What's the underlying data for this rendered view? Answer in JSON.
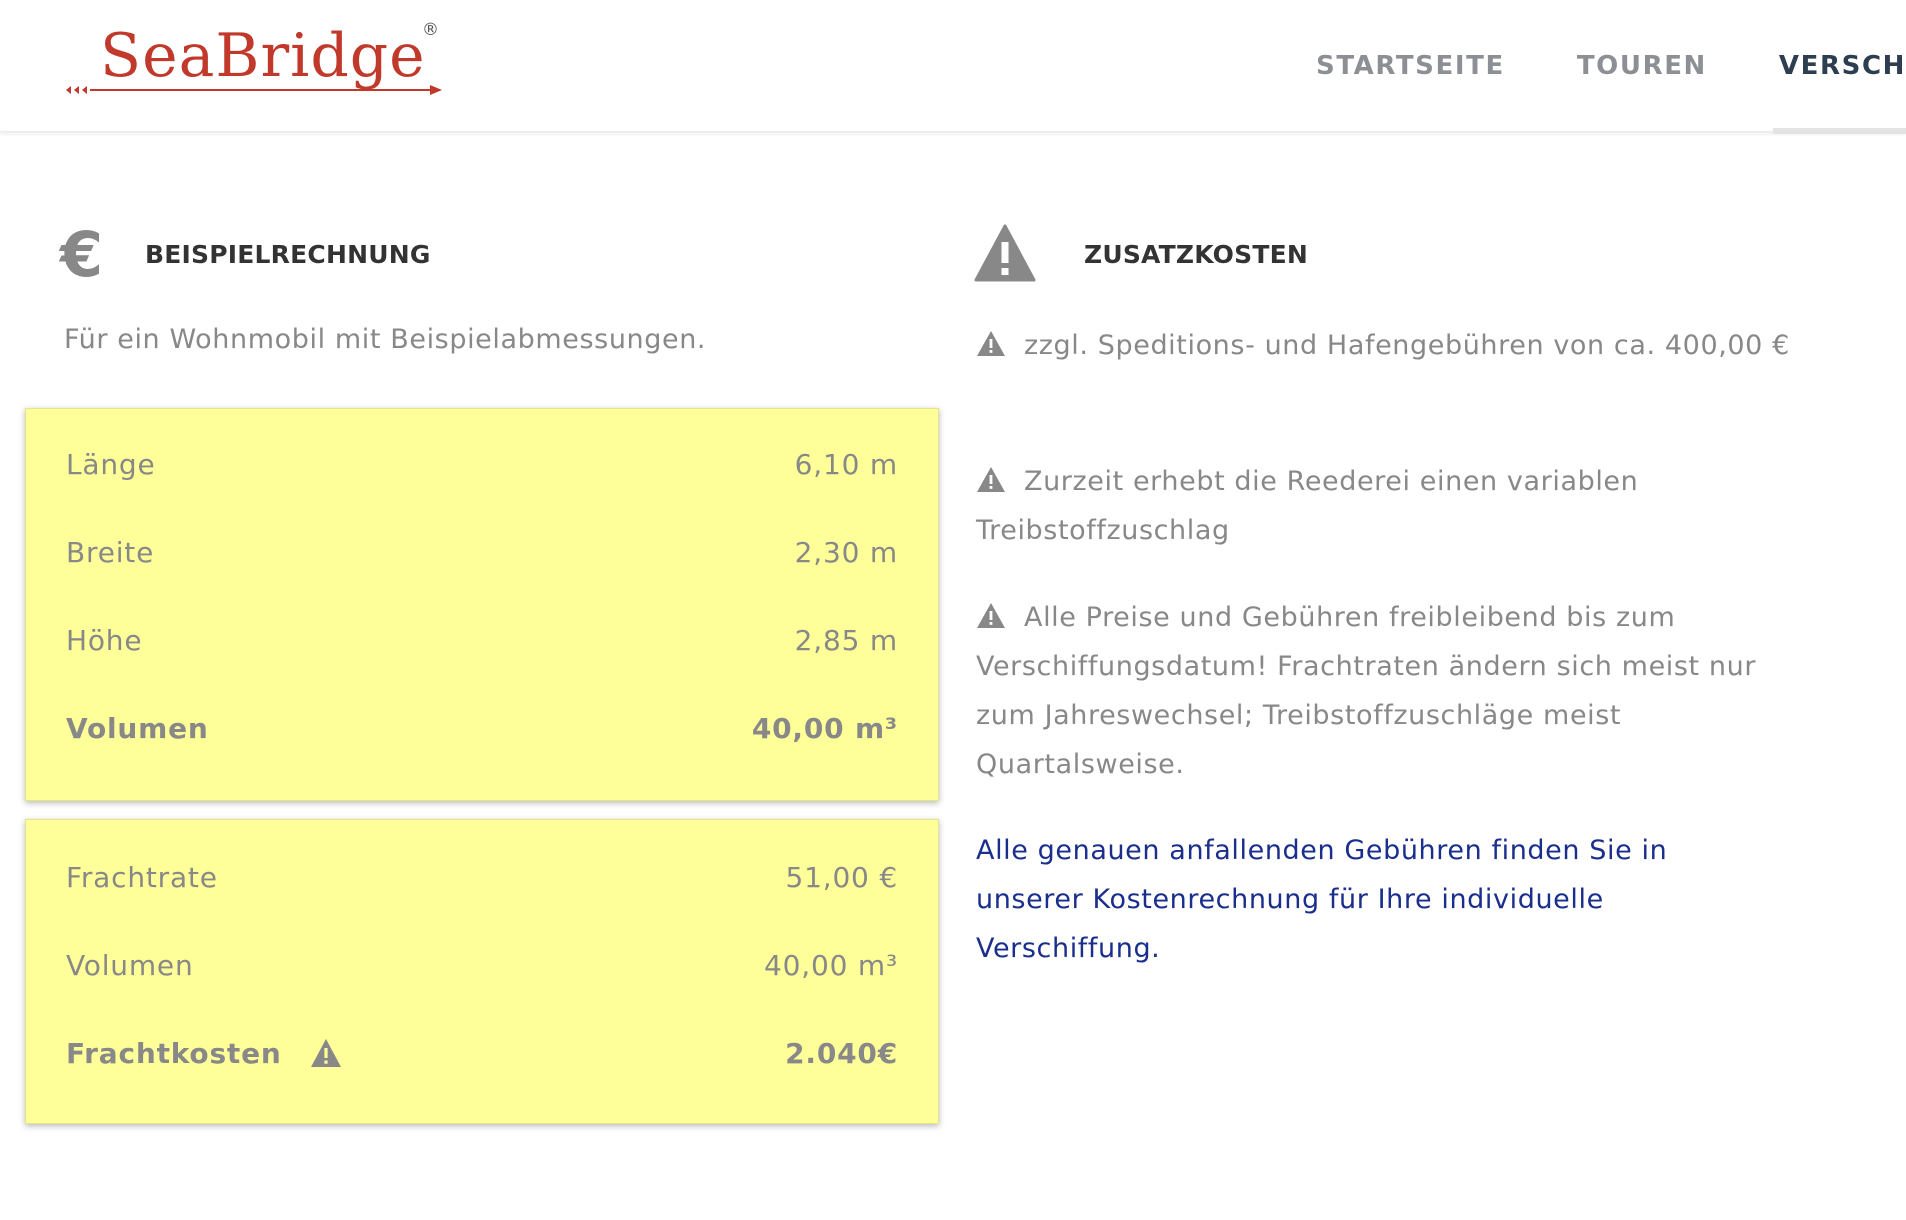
{
  "header": {
    "logo_text": "SeaBridge",
    "logo_reg": "®",
    "nav": [
      "STARTSEITE",
      "TOUREN",
      "VERSCH"
    ]
  },
  "beispiel": {
    "title": "BEISPIELRECHNUNG",
    "euro_icon": "€",
    "intro": "Für ein Wohnmobil mit Beispielabmessungen.",
    "box1": [
      {
        "label": "Länge",
        "value": "6,10 m"
      },
      {
        "label": "Breite",
        "value": "2,30 m"
      },
      {
        "label": "Höhe",
        "value": "2,85 m"
      },
      {
        "label": "Volumen",
        "value": "40,00 m³"
      }
    ],
    "box2": [
      {
        "label": "Frachtrate",
        "value": "51,00 €"
      },
      {
        "label": "Volumen",
        "value": "40,00 m³"
      },
      {
        "label": "Frachtkosten",
        "value": "2.040€"
      }
    ]
  },
  "zusatz": {
    "title": "ZUSATZKOSTEN",
    "items": [
      "zzgl. Speditions- und Hafengebühren von ca. 400,00 €",
      "Zurzeit erhebt die Reederei einen variablen Treibstoffzuschlag",
      "Alle Preise und Gebühren freibleibend bis zum Verschiffungsdatum! Frachtraten ändern sich meist nur zum Jahreswechsel; Treibstoffzuschläge meist Quartalsweise."
    ],
    "link": "Alle genauen anfallenden Gebühren finden Sie in unserer Kostenrechnung für Ihre individuelle Verschiffung."
  },
  "colors": {
    "box_bg": "#ffff99",
    "text_gray": "#888888",
    "link_blue": "#1a2e8c",
    "logo_red": "#c0392b",
    "nav_active": "#2c3e50"
  },
  "icons": {
    "section_left": "euro-icon",
    "section_right": "warning-icon",
    "inline": "warning-icon"
  }
}
